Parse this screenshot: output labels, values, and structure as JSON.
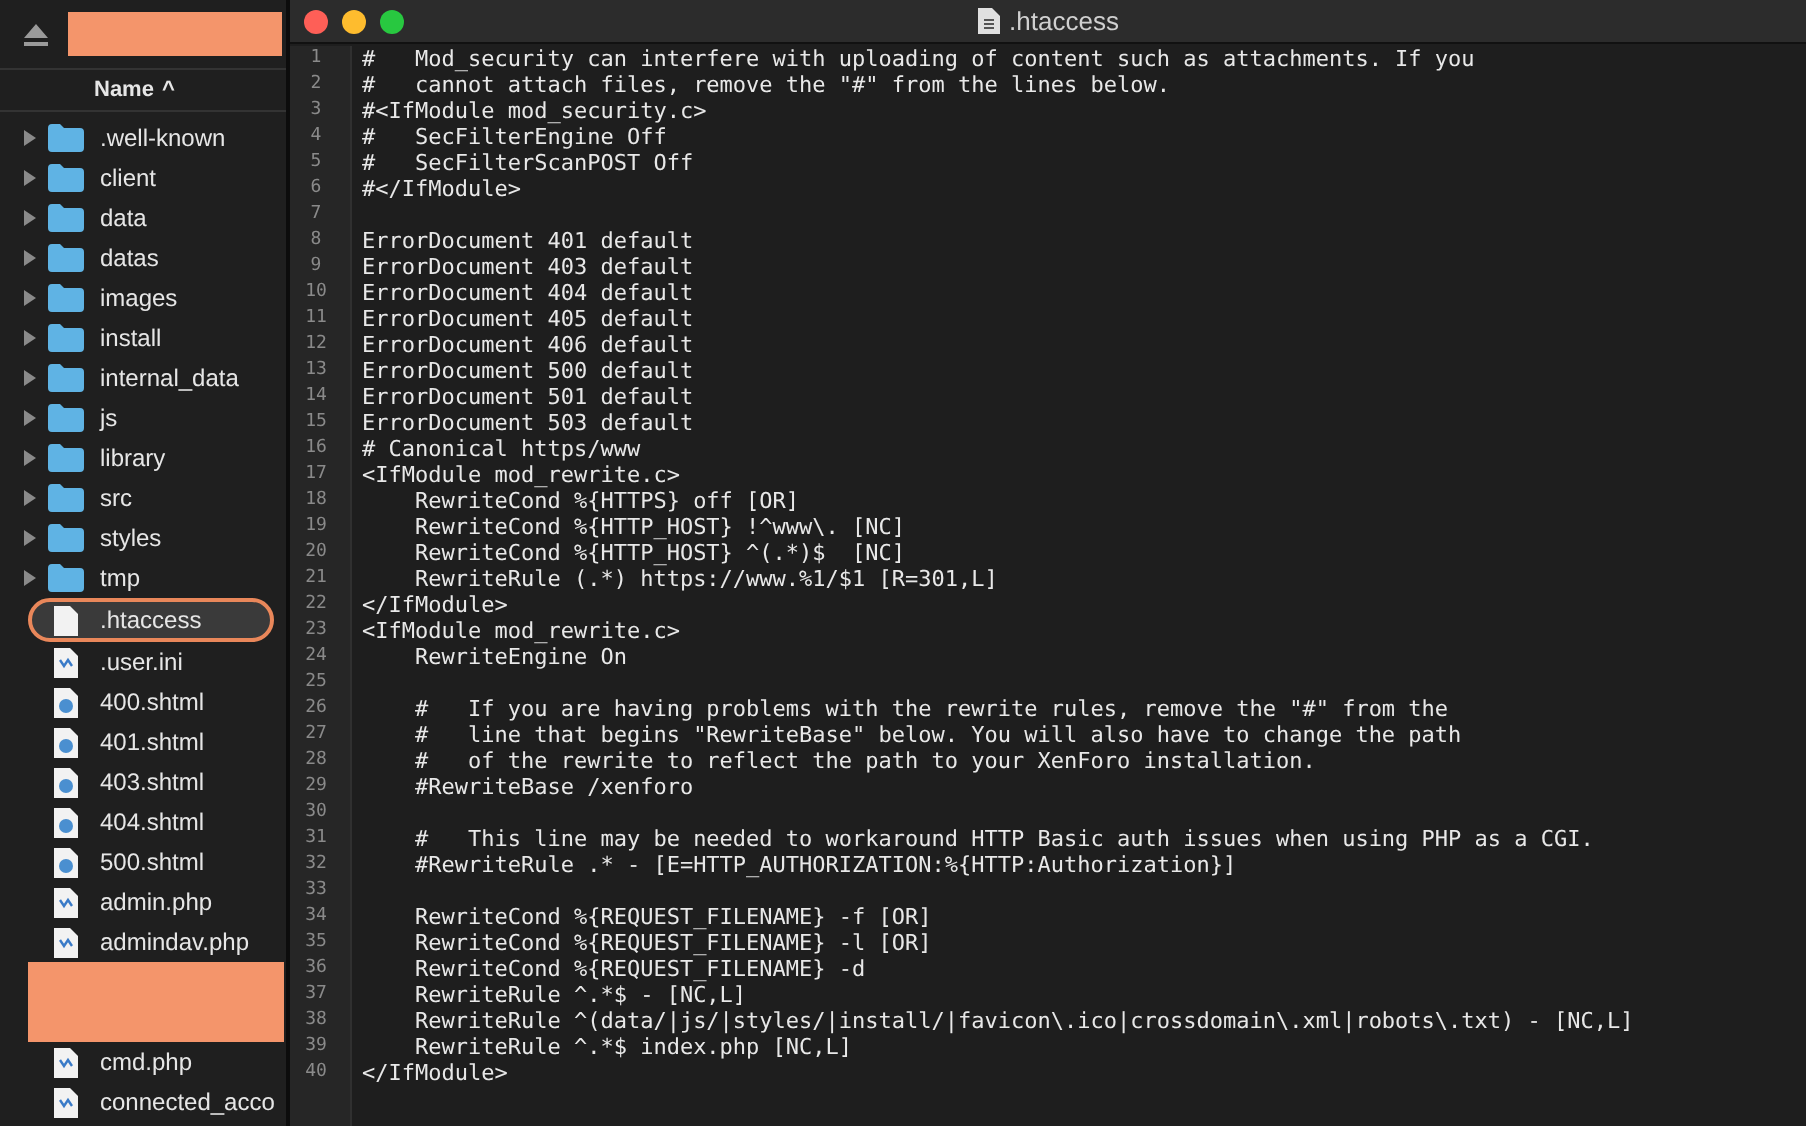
{
  "sidebar": {
    "column_header": {
      "label": "Name",
      "sort_indicator": "^"
    },
    "items": [
      {
        "name": ".well-known",
        "kind": "folder",
        "selected": false
      },
      {
        "name": "client",
        "kind": "folder",
        "selected": false
      },
      {
        "name": "data",
        "kind": "folder",
        "selected": false
      },
      {
        "name": "datas",
        "kind": "folder",
        "selected": false
      },
      {
        "name": "images",
        "kind": "folder",
        "selected": false
      },
      {
        "name": "install",
        "kind": "folder",
        "selected": false
      },
      {
        "name": "internal_data",
        "kind": "folder",
        "selected": false
      },
      {
        "name": "js",
        "kind": "folder",
        "selected": false
      },
      {
        "name": "library",
        "kind": "folder",
        "selected": false
      },
      {
        "name": "src",
        "kind": "folder",
        "selected": false
      },
      {
        "name": "styles",
        "kind": "folder",
        "selected": false
      },
      {
        "name": "tmp",
        "kind": "folder",
        "selected": false
      },
      {
        "name": ".htaccess",
        "kind": "file",
        "selected": true
      },
      {
        "name": ".user.ini",
        "kind": "php",
        "selected": false
      },
      {
        "name": "400.shtml",
        "kind": "html",
        "selected": false
      },
      {
        "name": "401.shtml",
        "kind": "html",
        "selected": false
      },
      {
        "name": "403.shtml",
        "kind": "html",
        "selected": false
      },
      {
        "name": "404.shtml",
        "kind": "html",
        "selected": false
      },
      {
        "name": "500.shtml",
        "kind": "html",
        "selected": false
      },
      {
        "name": "admin.php",
        "kind": "php",
        "selected": false
      },
      {
        "name": "admindav.php",
        "kind": "php",
        "selected": false
      },
      {
        "kind": "redacted"
      },
      {
        "name": "cmd.php",
        "kind": "php",
        "selected": false
      },
      {
        "name": "connected_acco",
        "kind": "php",
        "selected": false
      }
    ]
  },
  "editor": {
    "window": {
      "title": ".htaccess"
    },
    "lines": [
      {
        "number": "1",
        "text": "#   Mod_security can interfere with uploading of content such as attachments. If you"
      },
      {
        "number": "2",
        "text": "#   cannot attach files, remove the \"#\" from the lines below."
      },
      {
        "number": "3",
        "text": "#<IfModule mod_security.c>"
      },
      {
        "number": "4",
        "text": "#   SecFilterEngine Off"
      },
      {
        "number": "5",
        "text": "#   SecFilterScanPOST Off"
      },
      {
        "number": "6",
        "text": "#</IfModule>"
      },
      {
        "number": "7"
      },
      {
        "number": "8",
        "text": "ErrorDocument 401 default"
      },
      {
        "number": "9",
        "text": "ErrorDocument 403 default"
      },
      {
        "number": "10",
        "text": "ErrorDocument 404 default"
      },
      {
        "number": "11",
        "text": "ErrorDocument 405 default"
      },
      {
        "number": "12",
        "text": "ErrorDocument 406 default"
      },
      {
        "number": "13",
        "text": "ErrorDocument 500 default"
      },
      {
        "number": "14",
        "text": "ErrorDocument 501 default"
      },
      {
        "number": "15",
        "text": "ErrorDocument 503 default"
      },
      {
        "number": "16",
        "text": "# Canonical https/www"
      },
      {
        "number": "17",
        "text": "<IfModule mod_rewrite.c>"
      },
      {
        "number": "18",
        "text": "    RewriteCond %{HTTPS} off [OR]"
      },
      {
        "number": "19",
        "text": "    RewriteCond %{HTTP_HOST} !^www\\. [NC]"
      },
      {
        "number": "20",
        "text": "    RewriteCond %{HTTP_HOST} ^(.*)$  [NC]"
      },
      {
        "number": "21",
        "text": "    RewriteRule (.*) https://www.%1/$1 [R=301,L]"
      },
      {
        "number": "22",
        "text": "</IfModule>"
      },
      {
        "number": "23",
        "text": "<IfModule mod_rewrite.c>"
      },
      {
        "number": "24",
        "text": "    RewriteEngine On"
      },
      {
        "number": "25"
      },
      {
        "number": "26",
        "text": "    #   If you are having problems with the rewrite rules, remove the \"#\" from the"
      },
      {
        "number": "27",
        "text": "    #   line that begins \"RewriteBase\" below. You will also have to change the path"
      },
      {
        "number": "28",
        "text": "    #   of the rewrite to reflect the path to your XenForo installation."
      },
      {
        "number": "29",
        "text": "    #RewriteBase /xenforo"
      },
      {
        "number": "30"
      },
      {
        "number": "31",
        "text": "    #   This line may be needed to workaround HTTP Basic auth issues when using PHP as a CGI."
      },
      {
        "number": "32",
        "text": "    #RewriteRule .* - [E=HTTP_AUTHORIZATION:%{HTTP:Authorization}]"
      },
      {
        "number": "33"
      },
      {
        "number": "34",
        "text": "    RewriteCond %{REQUEST_FILENAME} -f [OR]"
      },
      {
        "number": "35",
        "text": "    RewriteCond %{REQUEST_FILENAME} -l [OR]"
      },
      {
        "number": "36",
        "text": "    RewriteCond %{REQUEST_FILENAME} -d"
      },
      {
        "number": "37",
        "text": "    RewriteRule ^.*$ - [NC,L]"
      },
      {
        "number": "38",
        "text": "    RewriteRule ^(data/|js/|styles/|install/|favicon\\.ico|crossdomain\\.xml|robots\\.txt) - [NC,L]"
      },
      {
        "number": "39",
        "text": "    RewriteRule ^.*$ index.php [NC,L]"
      },
      {
        "number": "40",
        "text": "</IfModule>"
      }
    ]
  }
}
